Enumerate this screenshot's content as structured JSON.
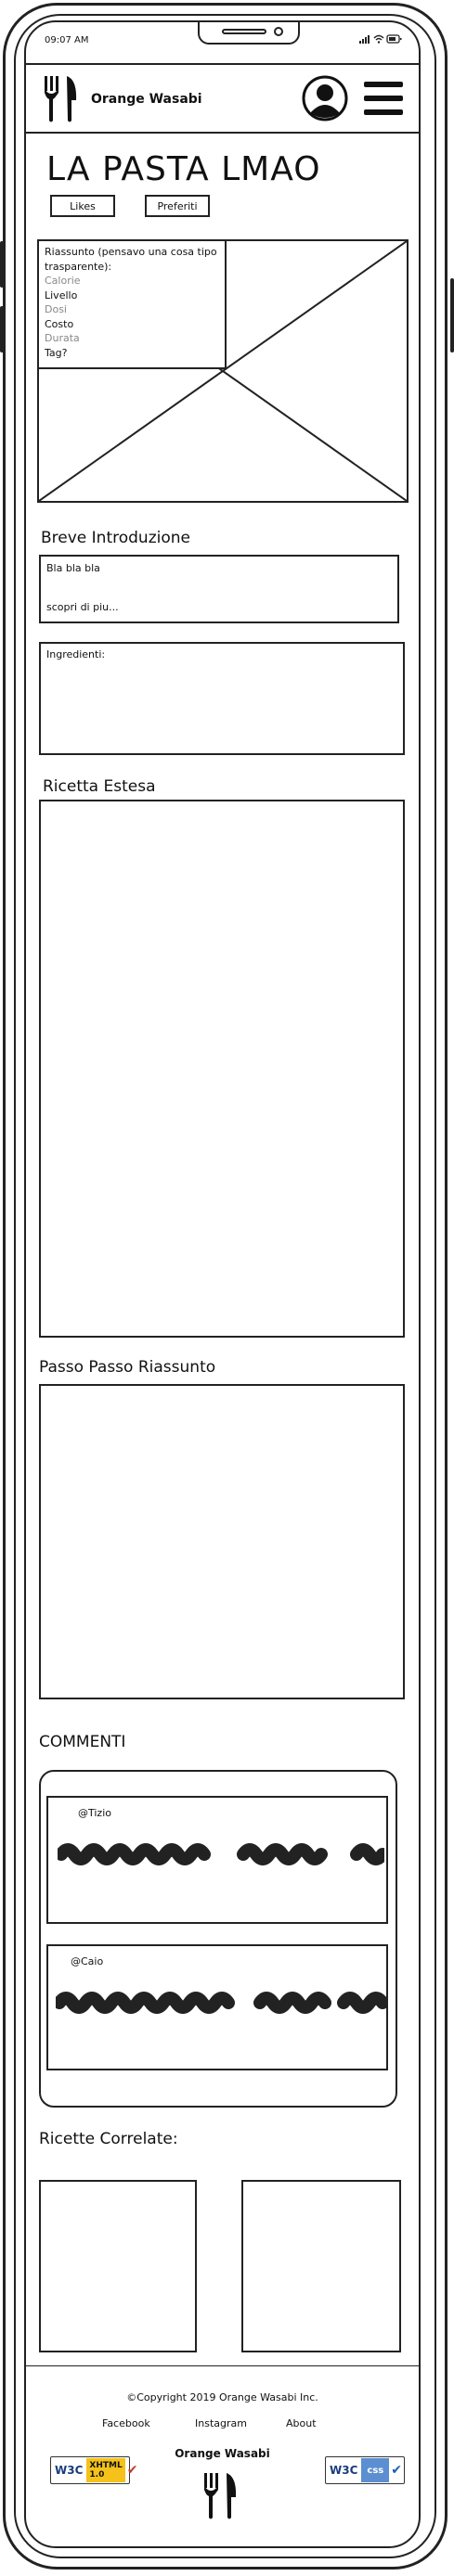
{
  "status_bar": {
    "time": "09:07 AM",
    "icons": "▂▄▆ ◠ ▭"
  },
  "header": {
    "brand": "Orange Wasabi"
  },
  "recipe": {
    "title": "LA PASTA LMAO",
    "likes_label": "Likes",
    "favorites_label": "Preferiti",
    "summary": {
      "title": "Riassunto (pensavo una cosa tipo trasparente):",
      "items": [
        {
          "label": "Calorie",
          "muted": true
        },
        {
          "label": "Livello",
          "muted": false
        },
        {
          "label": "Dosi",
          "muted": true
        },
        {
          "label": "Costo",
          "muted": false
        },
        {
          "label": "Durata",
          "muted": true
        },
        {
          "label": "Tag?",
          "muted": false
        }
      ]
    }
  },
  "intro": {
    "heading": "Breve Introduzione",
    "text": "Bla bla bla",
    "more_link": "scopri di piu..."
  },
  "ingredients": {
    "label": "Ingredienti:"
  },
  "extended_recipe": {
    "heading": "Ricetta Estesa"
  },
  "step_by_step": {
    "heading": "Passo Passo Riassunto"
  },
  "comments": {
    "heading": "COMMENTI",
    "items": [
      {
        "author": "@Tizio"
      },
      {
        "author": "@Caio"
      }
    ]
  },
  "related": {
    "heading": "Ricette Correlate:"
  },
  "footer": {
    "copyright": "©Copyright 2019 Orange Wasabi Inc.",
    "links": [
      "Facebook",
      "Instagram",
      "About"
    ],
    "brand": "Orange Wasabi",
    "badges": {
      "xhtml": {
        "w3c": "W3C",
        "name": "XHTML",
        "version": "1.0"
      },
      "css": {
        "w3c": "W3C",
        "name": "css"
      }
    }
  },
  "colors": {
    "outline": "#222222",
    "muted_text": "#888888",
    "badge_yellow": "#f4c21a",
    "badge_blue": "#5b8fd1"
  }
}
